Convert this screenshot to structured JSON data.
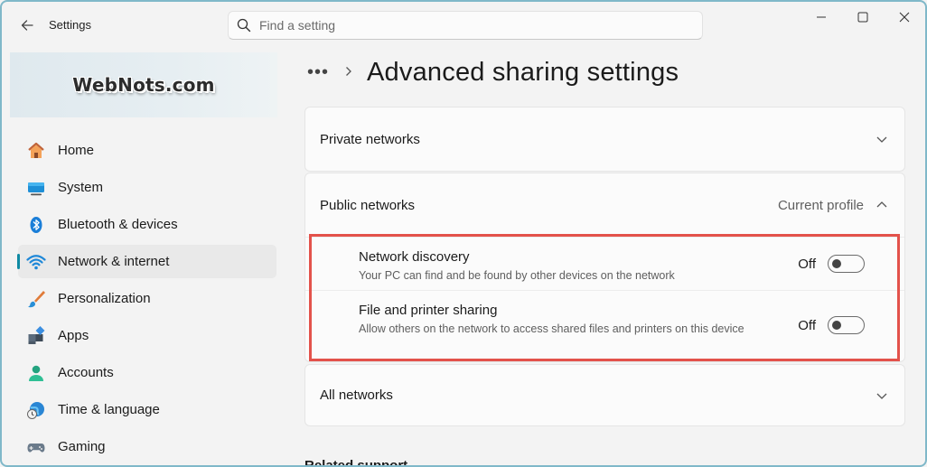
{
  "app": {
    "title": "Settings"
  },
  "search": {
    "placeholder": "Find a setting"
  },
  "logo": {
    "text": "WebNots.com"
  },
  "sidebar": {
    "items": [
      {
        "label": "Home",
        "icon": "home-icon"
      },
      {
        "label": "System",
        "icon": "system-icon"
      },
      {
        "label": "Bluetooth & devices",
        "icon": "bluetooth-icon"
      },
      {
        "label": "Network & internet",
        "icon": "wifi-icon",
        "active": true
      },
      {
        "label": "Personalization",
        "icon": "brush-icon"
      },
      {
        "label": "Apps",
        "icon": "apps-icon"
      },
      {
        "label": "Accounts",
        "icon": "accounts-icon"
      },
      {
        "label": "Time & language",
        "icon": "time-language-icon"
      },
      {
        "label": "Gaming",
        "icon": "gaming-icon"
      }
    ]
  },
  "breadcrumb": {
    "more": "•••",
    "title": "Advanced sharing settings"
  },
  "sections": {
    "private": {
      "label": "Private networks"
    },
    "public": {
      "label": "Public networks",
      "tag": "Current profile",
      "settings": [
        {
          "title": "Network discovery",
          "description": "Your PC can find and be found by other devices on the network",
          "state_label": "Off",
          "on": false
        },
        {
          "title": "File and printer sharing",
          "description": "Allow others on the network to access shared files and printers on this device",
          "state_label": "Off",
          "on": false
        }
      ]
    },
    "all": {
      "label": "All networks"
    }
  },
  "related": {
    "label": "Related support"
  },
  "colors": {
    "accent": "#0f8aa3",
    "highlight": "#e3524b"
  }
}
